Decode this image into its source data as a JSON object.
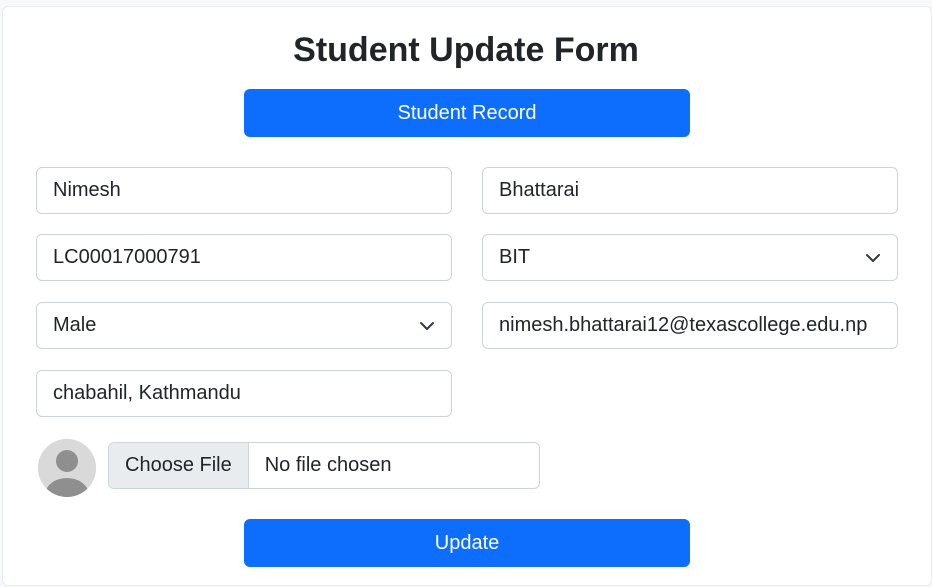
{
  "form": {
    "title": "Student Update Form",
    "record_button": "Student Record",
    "update_button": "Update",
    "first_name": "Nimesh",
    "last_name": "Bhattarai",
    "student_id": "LC00017000791",
    "program": "BIT",
    "gender": "Male",
    "email": "nimesh.bhattarai12@texascollege.edu.np",
    "address": "chabahil, Kathmandu",
    "file_button": "Choose File",
    "file_status": "No file chosen"
  },
  "icons": {
    "dropdown": "chevron-down-icon",
    "avatar": "user-avatar-icon"
  },
  "colors": {
    "primary": "#0d6efd",
    "border": "#ced4da",
    "file_button_bg": "#e9ecef"
  }
}
